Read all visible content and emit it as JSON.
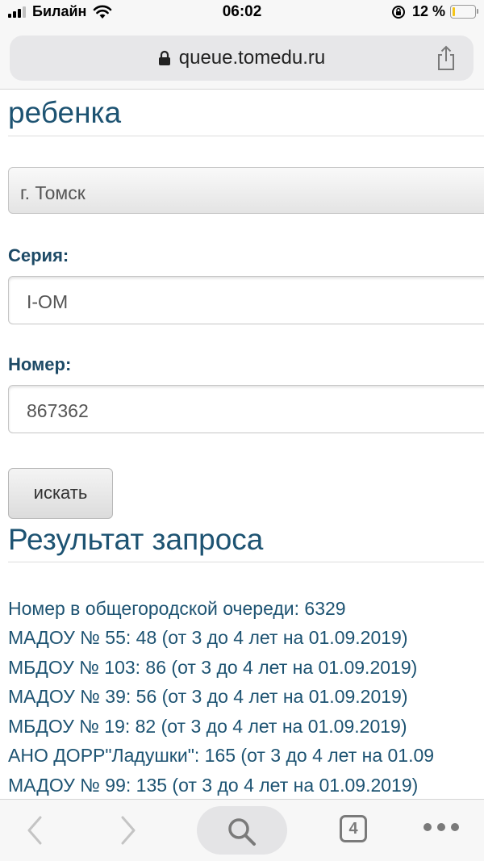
{
  "status_bar": {
    "carrier": "Билайн",
    "time": "06:02",
    "battery_percent": "12 %",
    "battery_level": 0.12
  },
  "address_bar": {
    "url": "queue.tomedu.ru"
  },
  "form": {
    "heading_fragment": "ребенка",
    "city_select_value": "г. Томск",
    "series_label": "Серия:",
    "series_value": "I-OM",
    "number_label": "Номер:",
    "number_value": "867362",
    "search_button_label": "искать"
  },
  "result": {
    "heading": "Результат запроса",
    "lines": [
      "Номер в общегородской очереди: 6329",
      "МАДОУ № 55: 48 (от 3 до 4 лет на 01.09.2019)",
      "МБДОУ № 103: 86 (от 3 до 4 лет на 01.09.2019)",
      "МАДОУ № 39: 56 (от 3 до 4 лет на 01.09.2019)",
      "МБДОУ № 19: 82 (от 3 до 4 лет на 01.09.2019)",
      "АНО ДОРР\"Ладушки\": 165 (от 3 до 4 лет на 01.09",
      "МАДОУ № 99: 135 (от 3 до 4 лет на 01.09.2019)"
    ]
  },
  "toolbar": {
    "tab_count": "4"
  },
  "icons": {
    "signal": "signal-icon",
    "wifi": "wifi-icon",
    "rotation_lock": "rotation-lock-icon",
    "battery": "battery-icon",
    "padlock": "padlock-icon",
    "share": "share-icon",
    "back": "back-icon",
    "forward": "forward-icon",
    "search": "search-icon",
    "tabs": "tabs-icon",
    "more": "more-icon"
  }
}
